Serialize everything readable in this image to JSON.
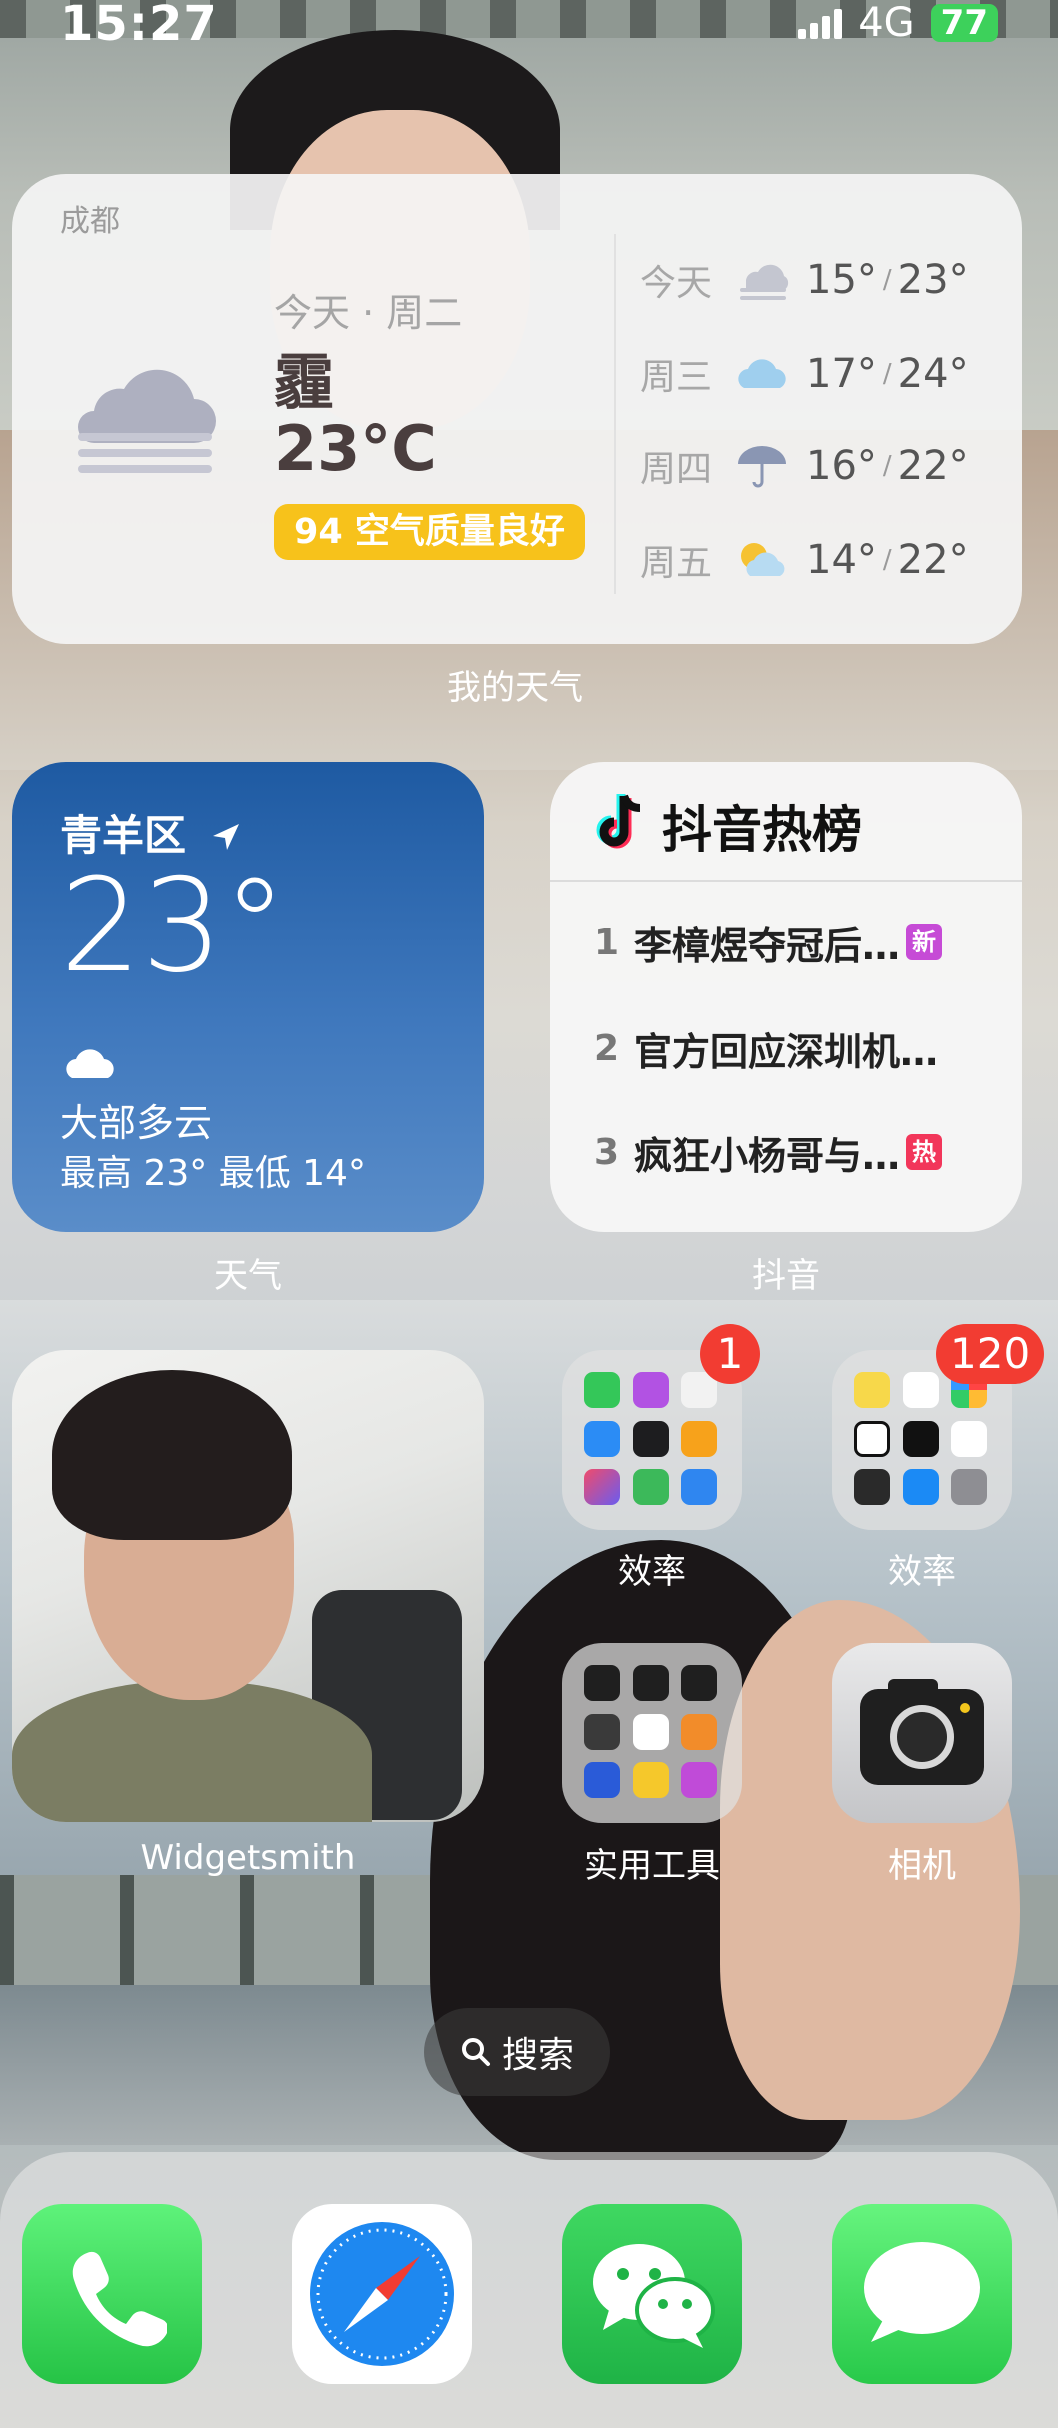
{
  "status_bar": {
    "time": "15:27",
    "network": "4G",
    "battery": "77"
  },
  "weather_widget_large": {
    "city": "成都",
    "day": "今天 · 周二",
    "condition": "霾",
    "temperature": "23°C",
    "aqi": "94 空气质量良好",
    "forecast": [
      {
        "day": "今天",
        "icon": "haze-icon",
        "low": "15°",
        "high": "23°"
      },
      {
        "day": "周三",
        "icon": "cloud-icon",
        "low": "17°",
        "high": "24°"
      },
      {
        "day": "周四",
        "icon": "umbrella-icon",
        "low": "16°",
        "high": "22°"
      },
      {
        "day": "周五",
        "icon": "partly-sunny-icon",
        "low": "14°",
        "high": "22°"
      }
    ],
    "label": "我的天气"
  },
  "weather_widget_small": {
    "location": "青羊区",
    "temperature": "23°",
    "condition": "大部多云",
    "hi_lo": "最高 23° 最低 14°",
    "label": "天气"
  },
  "douyin_widget": {
    "title": "抖音热榜",
    "items": [
      {
        "rank": "1",
        "text": "李樟煜夺冠后…",
        "badge": "新",
        "badge_color": "#c64bd6"
      },
      {
        "rank": "2",
        "text": "官方回应深圳机…",
        "badge": "",
        "badge_color": ""
      },
      {
        "rank": "3",
        "text": "疯狂小杨哥与…",
        "badge": "热",
        "badge_color": "#f2365a"
      }
    ],
    "label": "抖音"
  },
  "photo_widget": {
    "label": "Widgetsmith"
  },
  "apps": {
    "efficiency_1": {
      "label": "效率",
      "badge": "1"
    },
    "efficiency_2": {
      "label": "效率",
      "badge": "120"
    },
    "tools": {
      "label": "实用工具"
    },
    "camera": {
      "label": "相机"
    }
  },
  "search": {
    "label": "搜索"
  },
  "dock": [
    "phone-icon",
    "safari-icon",
    "wechat-icon",
    "messages-icon"
  ],
  "colors": {
    "aqi": "#f7c21b",
    "badge": "#f23c32",
    "battery": "#3dd15b"
  }
}
